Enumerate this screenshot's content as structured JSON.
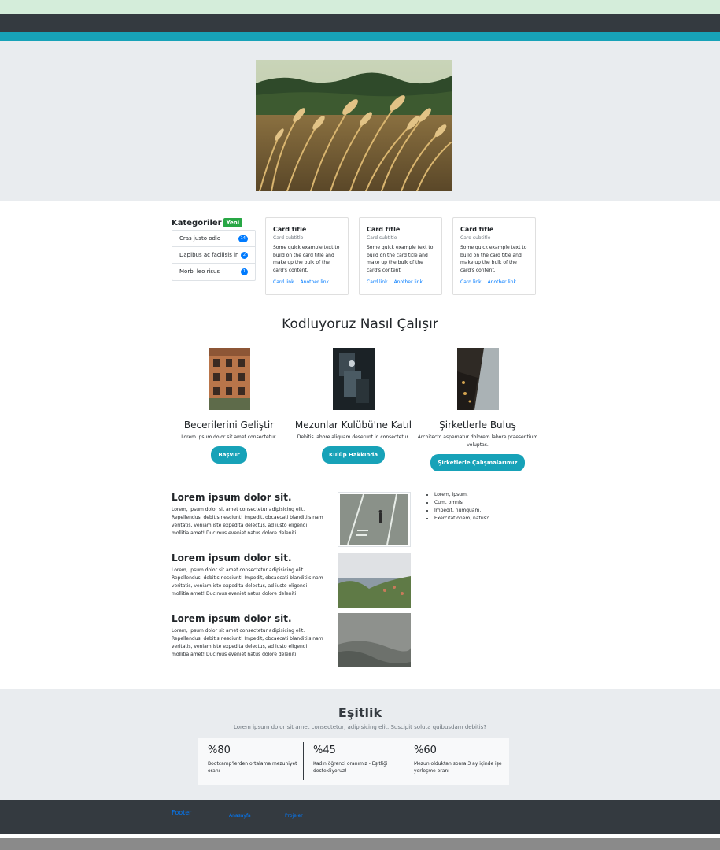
{
  "categories": {
    "title": "Kategoriler",
    "badge": "Yeni",
    "items": [
      {
        "label": "Cras justo odio",
        "count": "14"
      },
      {
        "label": "Dapibus ac facilisis in",
        "count": "2"
      },
      {
        "label": "Morbi leo risus",
        "count": "1"
      }
    ]
  },
  "cards": [
    {
      "title": "Card title",
      "subtitle": "Card subtitle",
      "text": "Some quick example text to build on the card title and make up the bulk of the card's content.",
      "link1": "Card link",
      "link2": "Another link"
    },
    {
      "title": "Card title",
      "subtitle": "Card subtitle",
      "text": "Some quick example text to build on the card title and make up the bulk of the card's content.",
      "link1": "Card link",
      "link2": "Another link"
    },
    {
      "title": "Card title",
      "subtitle": "Card subtitle",
      "text": "Some quick example text to build on the card title and make up the bulk of the card's content.",
      "link1": "Card link",
      "link2": "Another link"
    }
  ],
  "how": {
    "title": "Kodluyoruz Nasıl Çalışır",
    "features": [
      {
        "title": "Becerilerini Geliştir",
        "text": "Lorem ipsum dolor sit amet consectetur.",
        "button": "Başvur"
      },
      {
        "title": "Mezunlar Kulübü'ne Katıl",
        "text": "Debitis labore aliquam deserunt id consectetur.",
        "button": "Kulüp Hakkında"
      },
      {
        "title": "Şirketlerle Buluş",
        "text": "Architecto aspernatur dolorem labore praesentium voluptas.",
        "button": "Şirketlerle Çalışmalarımız"
      }
    ]
  },
  "lorem": [
    {
      "title": "Lorem ipsum dolor sit.",
      "text": "Lorem, ipsum dolor sit amet consectetur adipisicing elit. Repellendus, debitis nesciunt! Impedit, obcaecati blanditiis nam veritatis, veniam iste expedita delectus, ad iusto eligendi mollitia amet! Ducimus eveniet natus dolore deleniti!"
    },
    {
      "title": "Lorem ipsum dolor sit.",
      "text": "Lorem, ipsum dolor sit amet consectetur adipisicing elit. Repellendus, debitis nesciunt! Impedit, obcaecati blanditiis nam veritatis, veniam iste expedita delectus, ad iusto eligendi mollitia amet! Ducimus eveniet natus dolore deleniti!"
    },
    {
      "title": "Lorem ipsum dolor sit.",
      "text": "Lorem, ipsum dolor sit amet consectetur adipisicing elit. Repellendus, debitis nesciunt! Impedit, obcaecati blanditiis nam veritatis, veniam iste expedita delectus, ad iusto eligendi mollitia amet! Ducimus eveniet natus dolore deleniti!"
    }
  ],
  "bullets": [
    "Lorem, ipsum.",
    "Cum, omnis.",
    "Impedit, numquam.",
    "Exercitationem, natus?"
  ],
  "equality": {
    "title": "Eşitlik",
    "subtitle": "Lorem ipsum dolor sit amet consectetur, adipisicing elit. Suscipit soluta quibusdam debitis?",
    "stats": [
      {
        "value": "%80",
        "desc": "Bootcamp'lerden ortalama mezuniyet oranı"
      },
      {
        "value": "%45",
        "desc": "Kadın öğrenci oranımız - Eşitliği destekliyoruz!"
      },
      {
        "value": "%60",
        "desc": "Mezun olduktan sonra 3 ay içinde işe yerleşme oranı"
      }
    ]
  },
  "footer": {
    "title": "Footer",
    "link1": "Anasayfa",
    "link2": "Projeler"
  },
  "colors": {
    "teal": "#17a2b8",
    "dark": "#343a40",
    "green": "#28a745",
    "blue": "#007bff"
  }
}
